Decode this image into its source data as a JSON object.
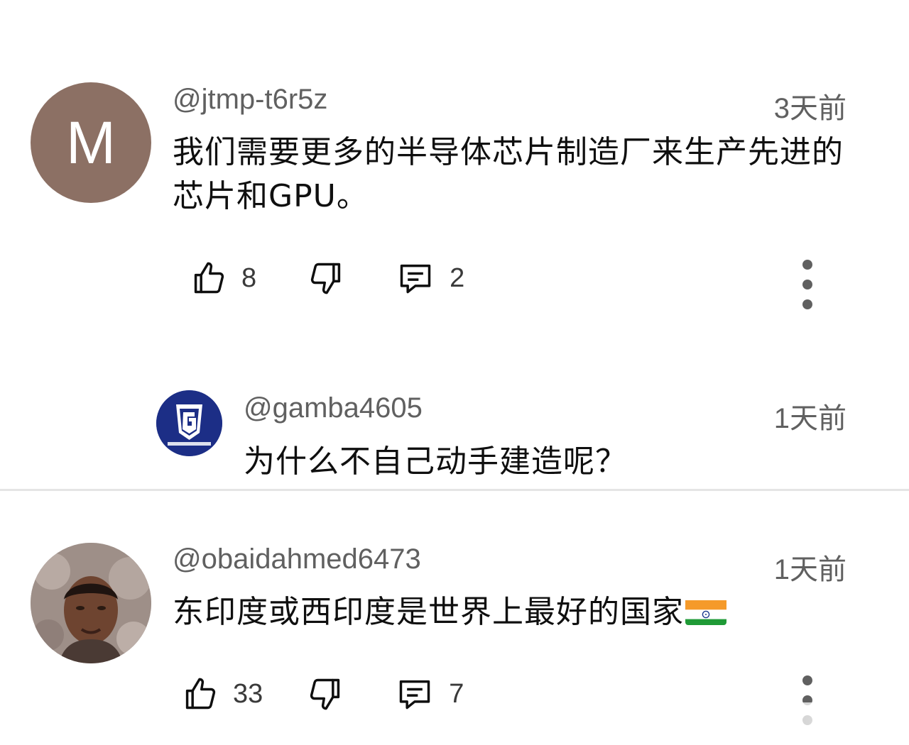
{
  "comments": [
    {
      "avatar_letter": "M",
      "avatar_color": "#8c7064",
      "author": "@jtmp-t6r5z",
      "time": "3天前",
      "text": "我们需要更多的半导体芯片制造厂来生产先进的芯片和GPU。",
      "likes": "8",
      "replies": "2"
    },
    {
      "author": "@gamba4605",
      "time": "1天前",
      "text": "为什么不自己动手建造呢？",
      "avatar_icon": "gamba-osaka-logo-icon"
    },
    {
      "author": "@obaidahmed6473",
      "time": "1天前",
      "text": "东印度或西印度是世界上最好的国家",
      "emoji": "india-flag-icon",
      "likes": "33",
      "replies": "7"
    }
  ],
  "colors": {
    "secondary_text": "#606060",
    "primary_text": "#0f0f0f",
    "divider": "#e5e5e5"
  }
}
